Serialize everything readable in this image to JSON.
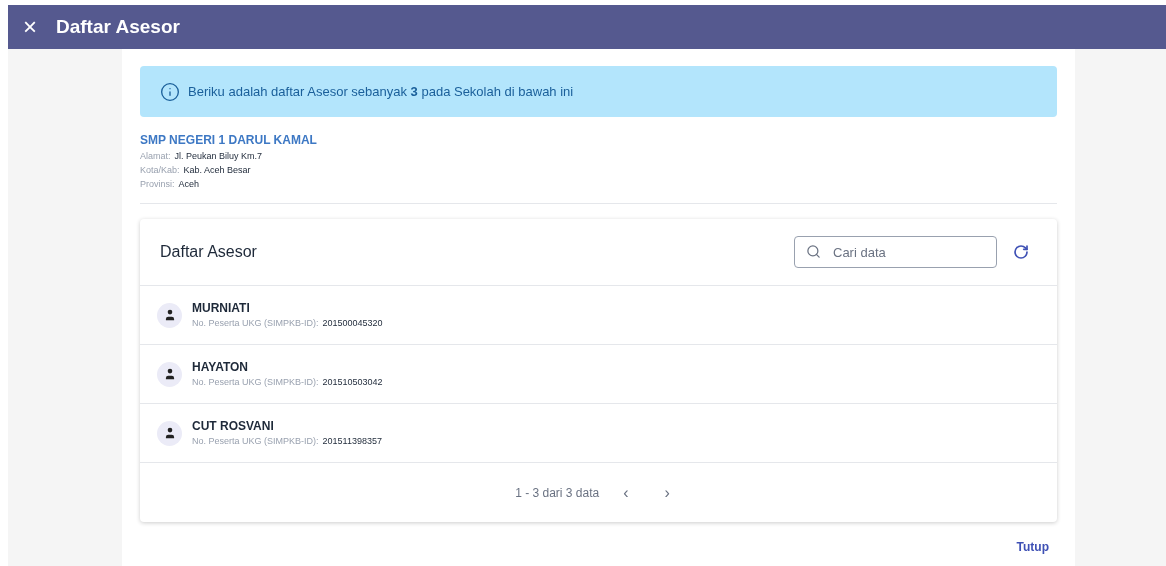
{
  "header": {
    "close_icon": "×",
    "title": "Daftar Asesor"
  },
  "info": {
    "text": "Beriku adalah daftar Asesor sebanyak **3** pada Sekolah di bawah ini"
  },
  "school": {
    "name": "SMP NEGERI 1 DARUL KAMAL",
    "details": [
      {
        "label": "Alamat:",
        "value": "Jl. Peukan Biluy Km.7"
      },
      {
        "label": "Kota/Kab:",
        "value": "Kab. Aceh Besar"
      },
      {
        "label": "Provinsi:",
        "value": "Aceh"
      }
    ]
  },
  "list": {
    "title": "Daftar Asesor",
    "search": {
      "placeholder": "Cari data"
    },
    "rows": [
      {
        "name": "MURNIATI",
        "id_label": "No. Peserta UKG (SIMPKB-ID):",
        "id": "201500045320"
      },
      {
        "name": "HAYATON",
        "id_label": "No. Peserta UKG (SIMPKB-ID):",
        "id": "201510503042"
      },
      {
        "name": "CUT ROSVANI",
        "id_label": "No. Peserta UKG (SIMPKB-ID):",
        "id": "201511398357"
      }
    ],
    "pagination": {
      "text": "1 - 3 dari 3 data",
      "prev": {
        "label": "‹",
        "disabled": true
      },
      "next": {
        "label": "›",
        "disabled": true
      }
    }
  },
  "buttons": [
    "Tutup"
  ]
}
